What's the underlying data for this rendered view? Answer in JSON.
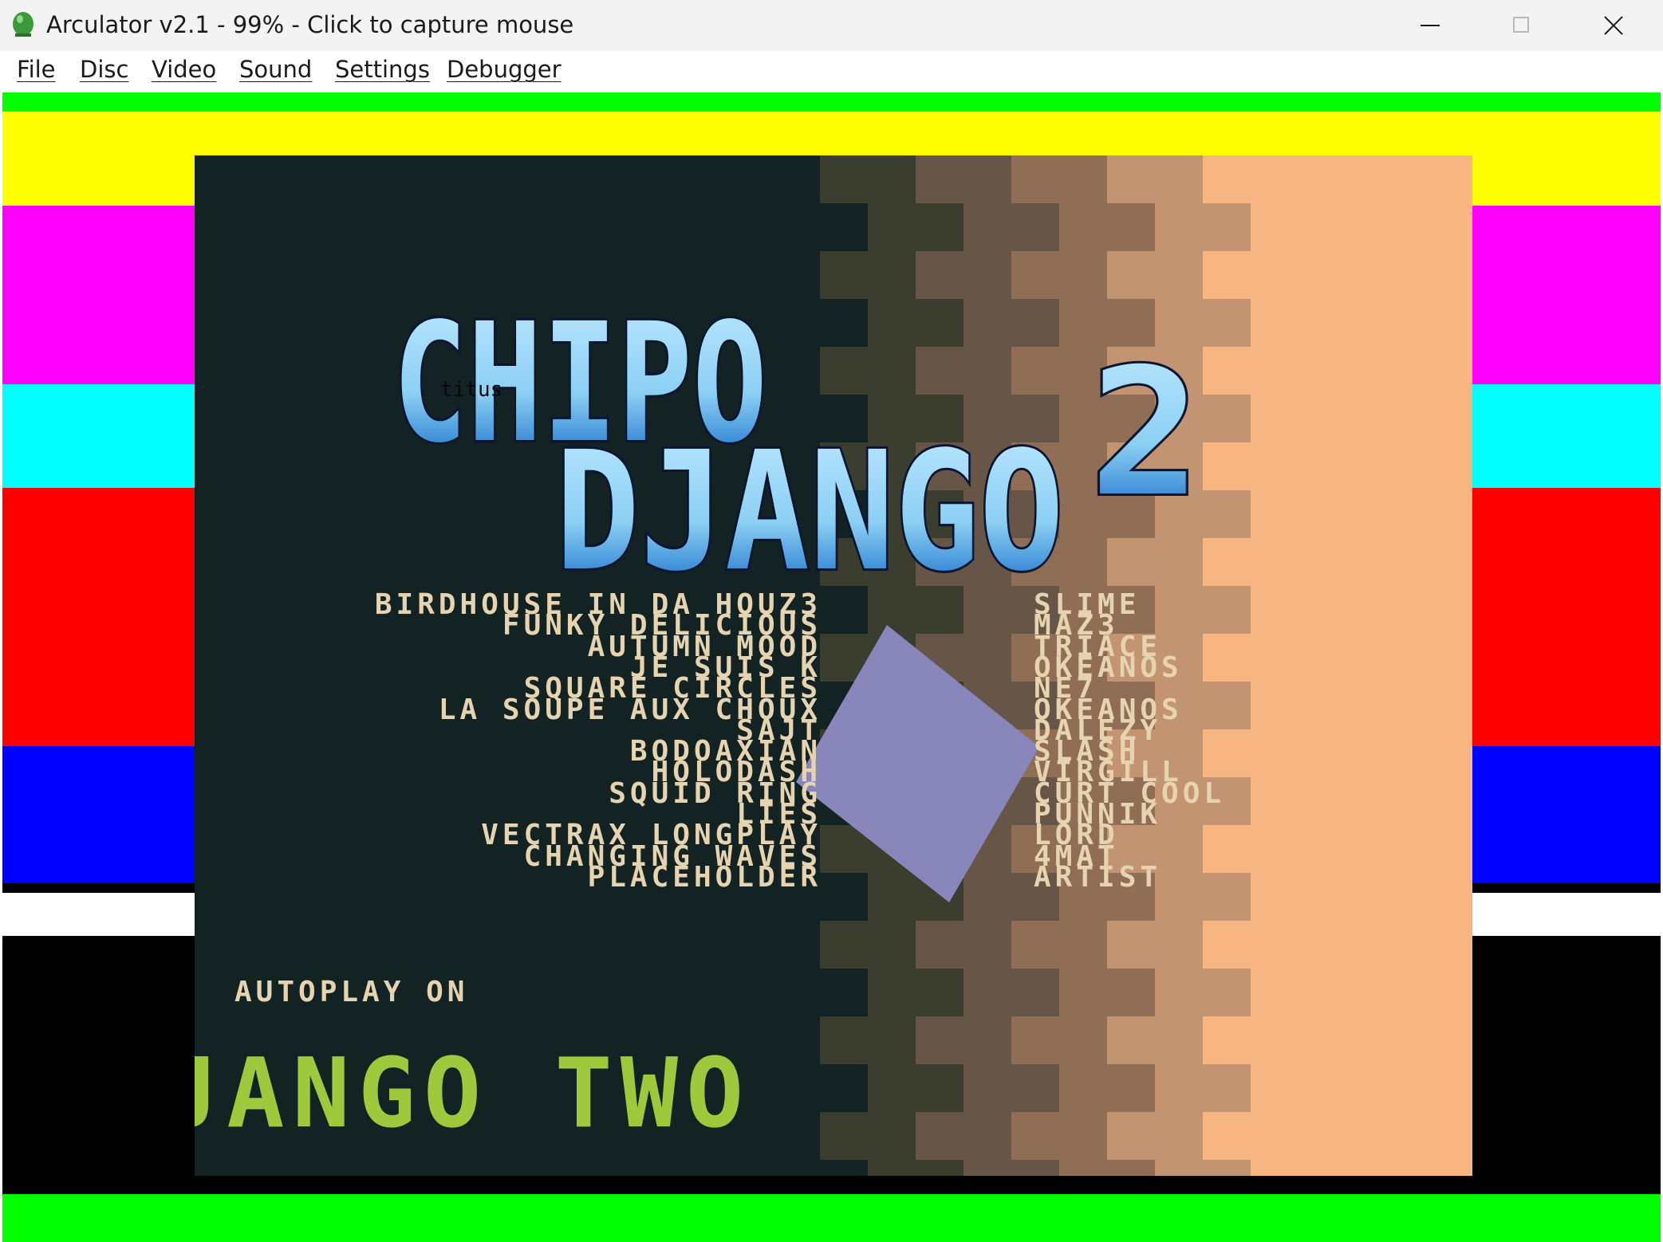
{
  "window": {
    "title": "Arculator v2.1 - 99% - Click to capture mouse",
    "icon": "arculator-icon",
    "controls": {
      "minimize": "minimize-icon",
      "maximize": "maximize-icon",
      "close": "close-icon"
    }
  },
  "menu": {
    "items": [
      "File",
      "Disc",
      "Video",
      "Sound",
      "Settings",
      "Debugger"
    ]
  },
  "colors": {
    "border_bands": [
      "#00ff00",
      "#ffff00",
      "#ff00ff",
      "#00ffff",
      "#ff0000",
      "#0000ff",
      "#ffffff",
      "#000000",
      "#00ff00"
    ],
    "screen_bg": "#132222",
    "track_text": "#e6d4b0",
    "scroller_text": "#9ec93c",
    "diamond": "#8886bb"
  },
  "demo": {
    "logo_line1": "CHIPO",
    "logo_line2": "DJANGO",
    "logo_number": "2",
    "logo_signature": "titus",
    "tracks": [
      {
        "title": "BIRDHOUSE IN DA HOUZ3",
        "artist": "SLIME"
      },
      {
        "title": "FUNKY DELICIOUS",
        "artist": "MAZ3"
      },
      {
        "title": "AUTUMN MOOD",
        "artist": "TRIACE"
      },
      {
        "title": "JE SUIS K",
        "artist": "OKEANOS"
      },
      {
        "title": "SQUARE CIRCLES",
        "artist": "NE7"
      },
      {
        "title": "LA SOUPE AUX CHOUX",
        "artist": "OKEANOS"
      },
      {
        "title": "SAJT",
        "artist": "DALEZY"
      },
      {
        "title": "BODOAXIAN",
        "artist": "SLASH"
      },
      {
        "title": "HOLODASH",
        "artist": "VIRGILL"
      },
      {
        "title": "SQUID RING",
        "artist": "CURT COOL"
      },
      {
        "title": "LIES",
        "artist": "PUNNIK"
      },
      {
        "title": "VECTRAX LONGPLAY",
        "artist": "LORD"
      },
      {
        "title": "CHANGING WAVES",
        "artist": "4MAT"
      },
      {
        "title": "PLACEHOLDER",
        "artist": "ARTIST"
      }
    ],
    "autoplay": "AUTOPLAY ON",
    "scroller": "JANGO TWO"
  }
}
